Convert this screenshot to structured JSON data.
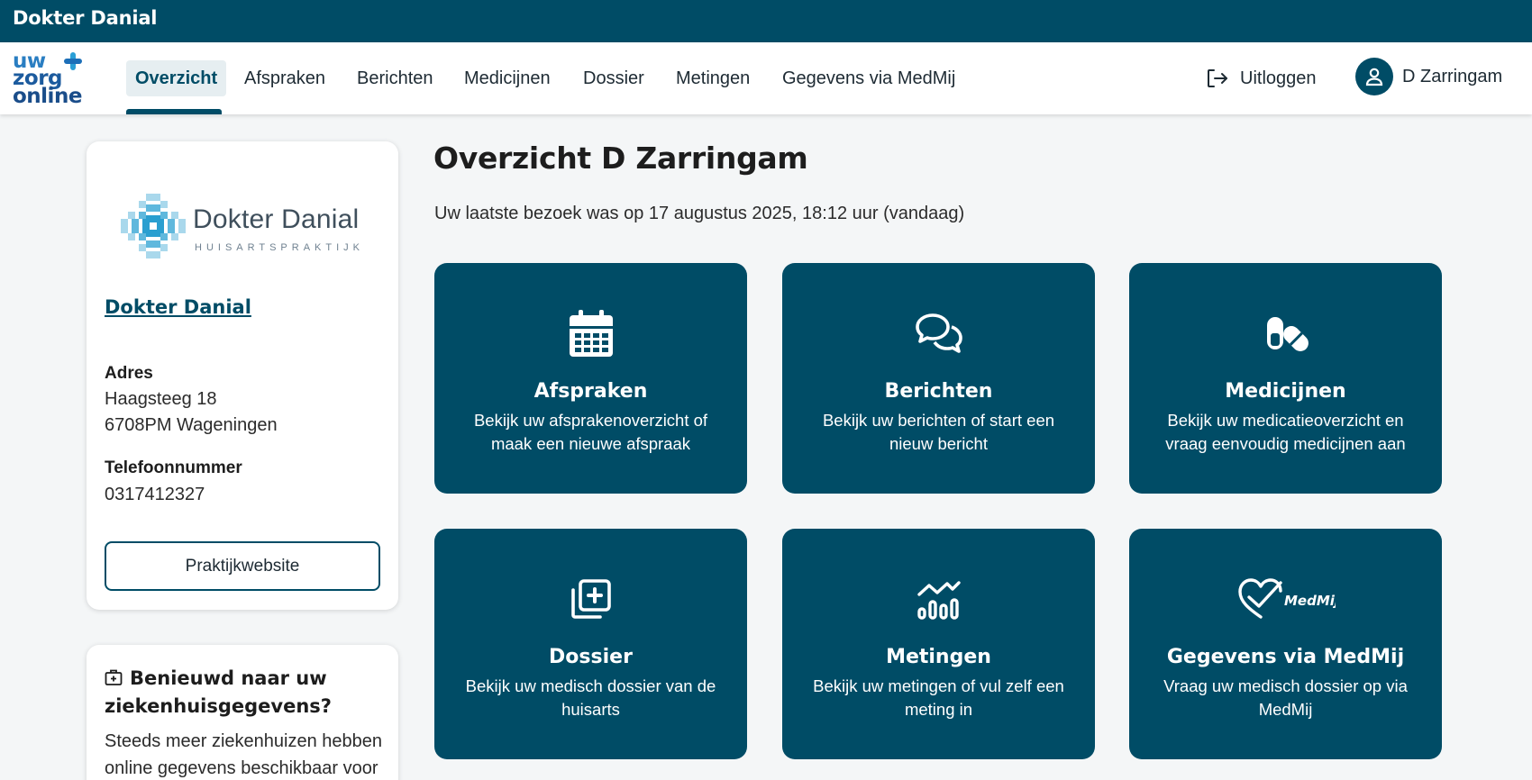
{
  "topbar": {
    "brand": "Dokter Danial"
  },
  "logo": {
    "line1": "uw",
    "line2": "zorg",
    "line3": "online"
  },
  "nav": {
    "items": [
      {
        "label": "Overzicht",
        "active": true
      },
      {
        "label": "Afspraken"
      },
      {
        "label": "Berichten"
      },
      {
        "label": "Medicijnen"
      },
      {
        "label": "Dossier"
      },
      {
        "label": "Metingen"
      },
      {
        "label": "Gegevens via MedMij"
      }
    ],
    "logout_label": "Uitloggen",
    "logout_icon": "logout-icon",
    "user_name": "D Zarringam",
    "user_icon": "user-icon"
  },
  "practice": {
    "logo_name": "Dokter Danial",
    "logo_sub": "HUISARTSPRAKTIJK",
    "link": "Dokter Danial",
    "address_label": "Adres",
    "address_line1": "Haagsteeg 18",
    "address_line2": "6708PM Wageningen",
    "phone_label": "Telefoonnummer",
    "phone": "0317412327",
    "website_button": "Praktijkwebsite"
  },
  "hospital": {
    "icon": "hospital-icon",
    "title": "Benieuwd naar uw ziekenhuisgegevens?",
    "text": "Steeds meer ziekenhuizen hebben online gegevens beschikbaar voor"
  },
  "main": {
    "title": "Overzicht D Zarringam",
    "last_visit": "Uw laatste bezoek was op 17 augustus 2025, 18:12 uur (vandaag)",
    "tiles": [
      {
        "icon": "calendar-icon",
        "title": "Afspraken",
        "desc": "Bekijk uw afsprakenoverzicht of maak een nieuwe afspraak"
      },
      {
        "icon": "chat-bubbles-icon",
        "title": "Berichten",
        "desc": "Bekijk uw berichten of start een nieuw bericht"
      },
      {
        "icon": "pills-icon",
        "title": "Medicijnen",
        "desc": "Bekijk uw medicatieoverzicht en vraag eenvoudig medicijnen aan"
      },
      {
        "icon": "medical-file-icon",
        "title": "Dossier",
        "desc": "Bekijk uw medisch dossier van de huisarts"
      },
      {
        "icon": "chart-icon",
        "title": "Metingen",
        "desc": "Bekijk uw metingen of vul zelf een meting in"
      },
      {
        "icon": "medmij-icon",
        "icon_text": "MedMij",
        "title": "Gegevens via MedMij",
        "desc": "Vraag uw medisch dossier op via MedMij"
      }
    ]
  },
  "colors": {
    "primary": "#004c66",
    "background": "#f4f6f7",
    "nav_active_bg": "#e6eef1"
  }
}
